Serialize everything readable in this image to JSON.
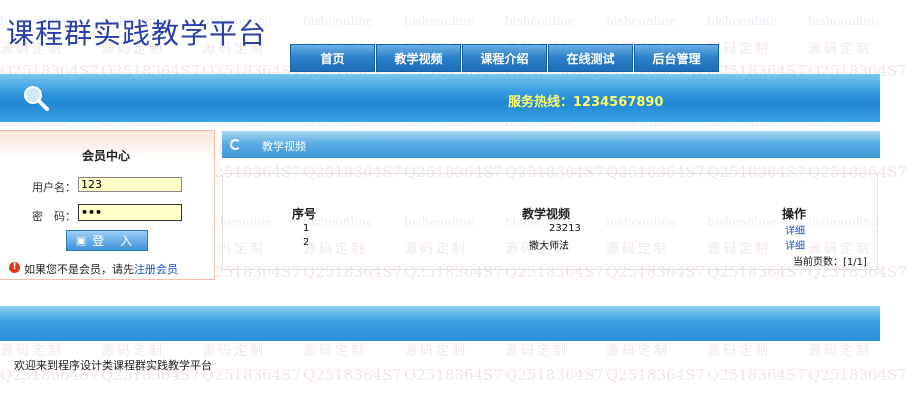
{
  "site": {
    "title": "课程群实践教学平台"
  },
  "watermarks": {
    "text_a": "bisheonline",
    "text_b": "源码定制",
    "text_c": "Q2518364S7"
  },
  "nav": {
    "items": [
      {
        "label": "首页"
      },
      {
        "label": "教学视频"
      },
      {
        "label": "课程介绍"
      },
      {
        "label": "在线测试"
      },
      {
        "label": "后台管理"
      }
    ]
  },
  "banner": {
    "hotline": "服务热线：1234567890"
  },
  "member": {
    "title": "会员中心",
    "username_label": "用户名：",
    "username_value": "123",
    "password_label": "密　码：",
    "password_value": "•••",
    "login_label": "登 入",
    "notice_text": "如果您不是会员，请先",
    "register_link": "注册会员"
  },
  "panel": {
    "title": "教学视频",
    "headers": {
      "index": "序号",
      "video": "教学视频",
      "action": "操作"
    },
    "rows": [
      {
        "index": "1",
        "video": "23213",
        "action": "详细"
      },
      {
        "index": "2",
        "video": "撒大师法",
        "action": "详细"
      }
    ],
    "pager": "当前页数：[1/1]"
  },
  "footer": {
    "text": "欢迎来到程序设计类课程群实践教学平台"
  }
}
